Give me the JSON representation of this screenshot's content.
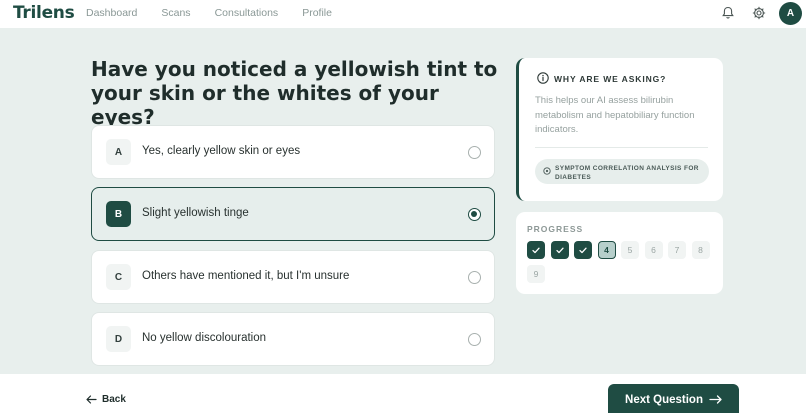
{
  "app": {
    "logo": "Trilens",
    "avatar_initial": "A"
  },
  "nav": [
    "Dashboard",
    "Scans",
    "Consultations",
    "Profile"
  ],
  "header_icons": [
    "bell-icon",
    "gear-icon"
  ],
  "question": "Have you noticed a yellowish tint to your skin or the whites of your eyes?",
  "options": [
    {
      "letter": "A",
      "label": "Yes, clearly yellow skin or eyes",
      "selected": false
    },
    {
      "letter": "B",
      "label": "Slight yellowish tinge",
      "selected": true
    },
    {
      "letter": "C",
      "label": "Others have mentioned it, but I'm unsure",
      "selected": false
    },
    {
      "letter": "D",
      "label": "No yellow discolouration",
      "selected": false
    }
  ],
  "why": {
    "title": "WHY ARE WE ASKING?",
    "text": "This helps our AI assess bilirubin metabolism and hepatobiliary function indicators.",
    "tag": "SYMPTOM CORRELATION ANALYSIS FOR DIABETES"
  },
  "progress": {
    "title": "PROGRESS",
    "current_step": 4,
    "total_steps": 9,
    "steps": [
      "1",
      "2",
      "3",
      "4",
      "5",
      "6",
      "7",
      "8",
      "9"
    ]
  },
  "footer": {
    "back_label": "Back",
    "next_label": "Next Question"
  },
  "colors": {
    "primary": "#1f4c43",
    "background": "#e8efed"
  }
}
